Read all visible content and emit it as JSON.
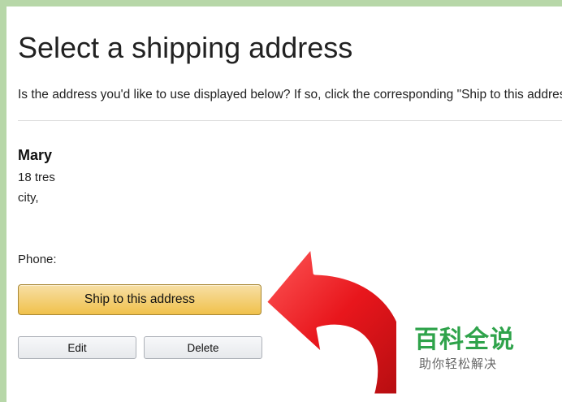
{
  "page": {
    "title": "Select a shipping address",
    "subtitle": "Is the address you'd like to use displayed below? If so, click the corresponding \"Ship to this address\" button."
  },
  "address": {
    "name": "Mary",
    "line1": "18 tres",
    "line2": "city,",
    "phone_label": "Phone:"
  },
  "buttons": {
    "ship": "Ship to this address",
    "edit": "Edit",
    "delete": "Delete"
  },
  "annotation": {
    "arrow_icon": "curved-arrow-icon",
    "arrow_color": "#e8161c"
  },
  "watermark": {
    "title": "百科全说",
    "subtitle": "助你轻松解决"
  },
  "colors": {
    "frame": "#b7d7a8",
    "ship_button": "#f0c14b",
    "watermark_green": "#2fa34b"
  }
}
